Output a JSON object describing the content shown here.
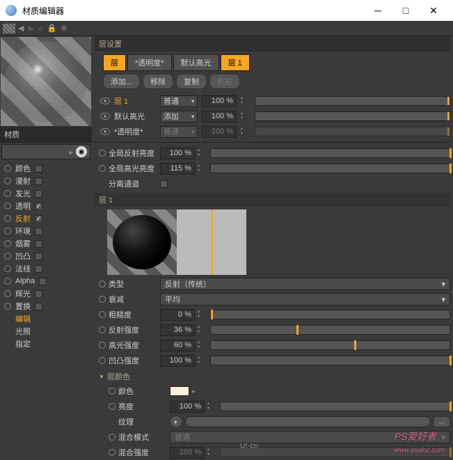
{
  "window": {
    "title": "材质编辑器"
  },
  "left": {
    "section": "材质",
    "channels": [
      {
        "label": "颜色",
        "checked": false,
        "sel": false
      },
      {
        "label": "漫射",
        "checked": false,
        "sel": false
      },
      {
        "label": "发光",
        "checked": false,
        "sel": false
      },
      {
        "label": "透明",
        "checked": true,
        "sel": false
      },
      {
        "label": "反射",
        "checked": true,
        "sel": true
      },
      {
        "label": "环境",
        "checked": false,
        "sel": false
      },
      {
        "label": "烟雾",
        "checked": false,
        "sel": false
      },
      {
        "label": "凹凸",
        "checked": false,
        "sel": false
      },
      {
        "label": "法线",
        "checked": false,
        "sel": false
      },
      {
        "label": "Alpha",
        "checked": false,
        "sel": false
      },
      {
        "label": "辉光",
        "checked": false,
        "sel": false
      },
      {
        "label": "置换",
        "checked": false,
        "sel": false
      }
    ],
    "subs": [
      "编辑",
      "光照",
      "指定"
    ]
  },
  "right": {
    "header": "层设置",
    "tabs": [
      {
        "label": "层",
        "sel": true
      },
      {
        "label": "*透明度*",
        "sel": false
      },
      {
        "label": "默认高光",
        "sel": false
      },
      {
        "label": "层 1",
        "sel": true
      }
    ],
    "buttons": [
      {
        "label": "添加...",
        "dis": false
      },
      {
        "label": "移除",
        "dis": false
      },
      {
        "label": "复制",
        "dis": false
      },
      {
        "label": "粘贴",
        "dis": true
      }
    ],
    "layers": [
      {
        "name": "层 1",
        "mode": "普通",
        "pct": "100 %",
        "sel": true,
        "dis": false
      },
      {
        "name": "默认高光",
        "mode": "添加",
        "pct": "100 %",
        "sel": false,
        "dis": false
      },
      {
        "name": "*透明度*",
        "mode": "普通",
        "pct": "100 %",
        "sel": false,
        "dis": true
      }
    ],
    "globals": [
      {
        "label": "全局反射亮度",
        "val": "100 %"
      },
      {
        "label": "全局高光亮度",
        "val": "115 %"
      }
    ],
    "separate": "分离通道",
    "layer1_label": "层 1",
    "type_label": "类型",
    "type_val": "反射（传统）",
    "atten_label": "衰减",
    "atten_val": "平均",
    "params": [
      {
        "label": "粗糙度",
        "val": "0 %",
        "pos": 0
      },
      {
        "label": "反射强度",
        "val": "36 %",
        "pos": 36
      },
      {
        "label": "高光强度",
        "val": "60 %",
        "pos": 60
      },
      {
        "label": "凹凸强度",
        "val": "100 %",
        "pos": 100
      }
    ],
    "group_color": "层颜色",
    "color_label": "颜色",
    "bright_label": "亮度",
    "bright_val": "100 %",
    "tex_label": "纹理",
    "blend_mode_label": "混合模式",
    "blend_mode_val": "普通",
    "blend_str_label": "混合强度",
    "blend_str_val": "100 %"
  },
  "watermark": "PS爱好者",
  "watermark_url": "www.psahz.com",
  "watermark2": "UI·cn"
}
